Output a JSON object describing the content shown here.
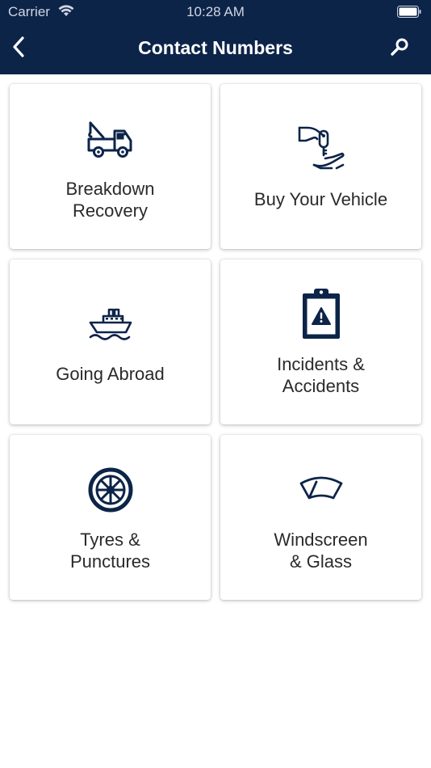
{
  "status_bar": {
    "carrier": "Carrier",
    "time": "10:28 AM"
  },
  "nav": {
    "title": "Contact Numbers",
    "back_icon": "chevron-left-icon",
    "search_icon": "search-icon"
  },
  "colors": {
    "header_bg": "#0d2449",
    "icon": "#0d2449",
    "label": "#2a2a2a"
  },
  "tiles": [
    {
      "label": "Breakdown\nRecovery",
      "icon": "tow-truck-icon"
    },
    {
      "label": "Buy Your Vehicle",
      "icon": "key-handover-icon"
    },
    {
      "label": "Going Abroad",
      "icon": "ferry-icon"
    },
    {
      "label": "Incidents &\nAccidents",
      "icon": "clipboard-warning-icon"
    },
    {
      "label": "Tyres &\nPunctures",
      "icon": "wheel-icon"
    },
    {
      "label": "Windscreen\n& Glass",
      "icon": "windscreen-icon"
    }
  ]
}
